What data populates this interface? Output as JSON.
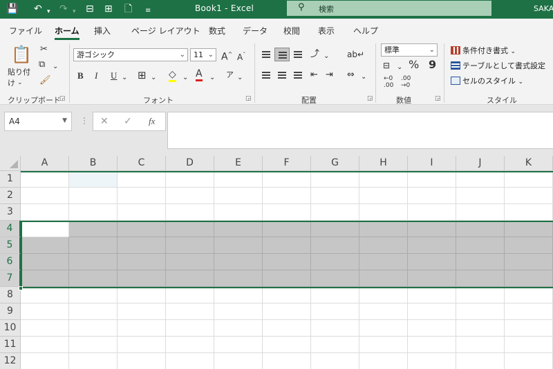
{
  "titlebar": {
    "title": "Book1  -  Excel",
    "search_placeholder": "検索",
    "user": "SAKA",
    "qa_icons": [
      "save-icon",
      "undo-icon",
      "redo-icon",
      "table-icon",
      "form-icon",
      "new-doc-icon",
      "customize-icon"
    ]
  },
  "tabs": [
    "ファイル",
    "ホーム",
    "挿入",
    "ページ レイアウト",
    "数式",
    "データ",
    "校閲",
    "表示",
    "ヘルプ"
  ],
  "active_tab": "ホーム",
  "ribbon": {
    "clipboard": {
      "label": "クリップボード",
      "paste": "貼り付け"
    },
    "font": {
      "label": "フォント",
      "name": "游ゴシック",
      "size": "11",
      "bold": "B",
      "italic": "I",
      "underline": "U",
      "grow": "A",
      "shrink": "A",
      "phonetic": "ア"
    },
    "alignment": {
      "label": "配置"
    },
    "number": {
      "label": "数値",
      "format": "標準",
      "percent": "%",
      "comma": "9"
    },
    "styles": {
      "label": "スタイル",
      "conditional": "条件付き書式",
      "table": "テーブルとして書式設定",
      "cell": "セルのスタイル"
    }
  },
  "formula_bar": {
    "name_box": "A4",
    "cancel": "✕",
    "enter": "✓",
    "fx": "fx",
    "formula": ""
  },
  "grid": {
    "columns": [
      "A",
      "B",
      "C",
      "D",
      "E",
      "F",
      "G",
      "H",
      "I",
      "J",
      "K"
    ],
    "rows": [
      "1",
      "2",
      "3",
      "4",
      "5",
      "6",
      "7",
      "8",
      "9",
      "10",
      "11",
      "12"
    ],
    "active_cell": "A4",
    "selection": "A4:K7"
  },
  "colors": {
    "accent": "#1e7145",
    "selection_fill": "#c6c6c6"
  }
}
